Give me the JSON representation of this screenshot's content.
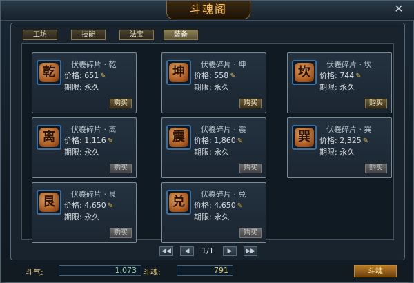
{
  "window": {
    "title": "斗魂阁",
    "close_symbol": "✕"
  },
  "tabs": [
    {
      "label": "工坊",
      "active": false
    },
    {
      "label": "技能",
      "active": false
    },
    {
      "label": "法宝",
      "active": false
    },
    {
      "label": "装备",
      "active": true
    }
  ],
  "items": [
    {
      "name": "伏羲碎片 · 乾",
      "glyph": "乾",
      "price_label": "价格:",
      "price": "651",
      "limit_label": "期限:",
      "limit": "永久",
      "buy_label": "购买",
      "buy_enabled": true
    },
    {
      "name": "伏羲碎片 · 坤",
      "glyph": "坤",
      "price_label": "价格:",
      "price": "558",
      "limit_label": "期限:",
      "limit": "永久",
      "buy_label": "购买",
      "buy_enabled": true
    },
    {
      "name": "伏羲碎片 · 坎",
      "glyph": "坎",
      "price_label": "价格:",
      "price": "744",
      "limit_label": "期限:",
      "limit": "永久",
      "buy_label": "购买",
      "buy_enabled": true
    },
    {
      "name": "伏羲碎片 · 离",
      "glyph": "离",
      "price_label": "价格:",
      "price": "1,116",
      "limit_label": "期限:",
      "limit": "永久",
      "buy_label": "购买",
      "buy_enabled": false
    },
    {
      "name": "伏羲碎片 · 震",
      "glyph": "震",
      "price_label": "价格:",
      "price": "1,860",
      "limit_label": "期限:",
      "limit": "永久",
      "buy_label": "购买",
      "buy_enabled": false
    },
    {
      "name": "伏羲碎片 · 巽",
      "glyph": "巽",
      "price_label": "价格:",
      "price": "2,325",
      "limit_label": "期限:",
      "limit": "永久",
      "buy_label": "购买",
      "buy_enabled": false
    },
    {
      "name": "伏羲碎片 · 艮",
      "glyph": "艮",
      "price_label": "价格:",
      "price": "4,650",
      "limit_label": "期限:",
      "limit": "永久",
      "buy_label": "购买",
      "buy_enabled": false
    },
    {
      "name": "伏羲碎片 · 兑",
      "glyph": "兑",
      "price_label": "价格:",
      "price": "4,650",
      "limit_label": "期限:",
      "limit": "永久",
      "buy_label": "购买",
      "buy_enabled": false
    }
  ],
  "pager": {
    "first": "◀◀",
    "prev": "◀",
    "page": "1/1",
    "next": "▶",
    "last": "▶▶"
  },
  "footer": {
    "douqi_label": "斗气:",
    "douqi_value": "1,073",
    "douhun_label": "斗魂:",
    "douhun_value": "791",
    "action_label": "斗魂"
  },
  "colors": {
    "accent": "#f3c55a",
    "panel": "#18232d",
    "border": "#7a8a96"
  }
}
